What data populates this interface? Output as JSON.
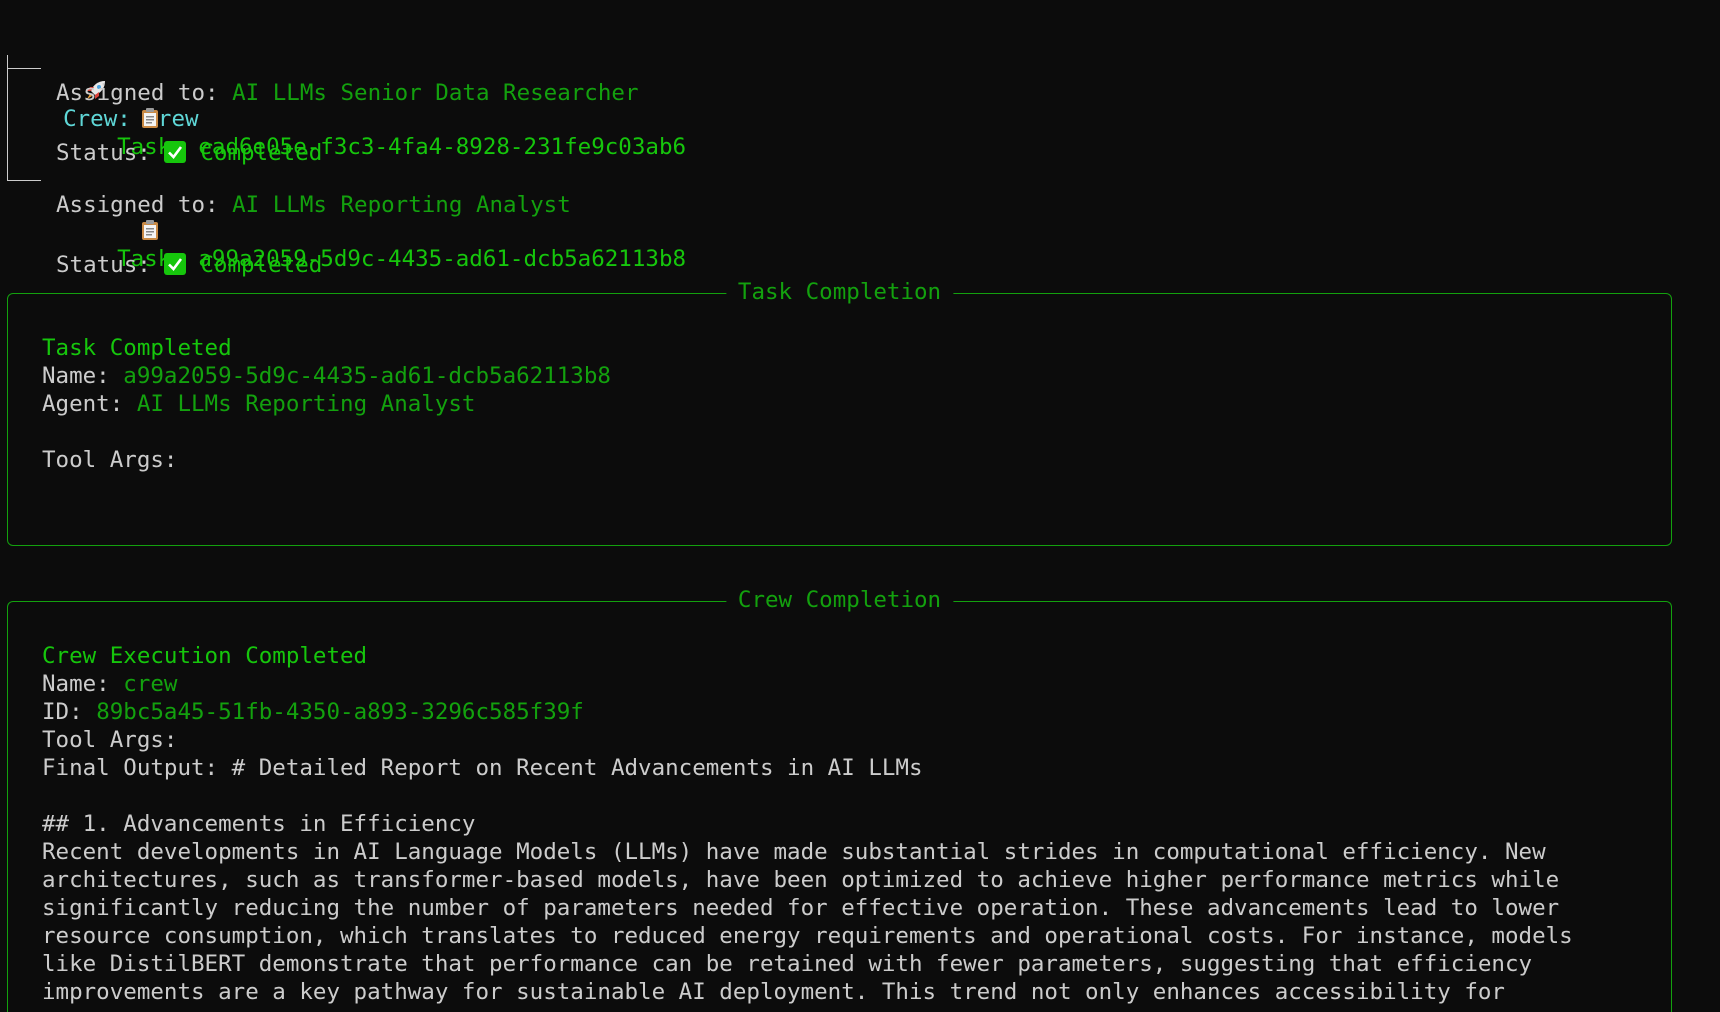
{
  "crew": {
    "label": "Crew:",
    "name": "crew"
  },
  "tasks": [
    {
      "label": "Task:",
      "id": "ead6e05e-f3c3-4fa4-8928-231fe9c03ab6",
      "assigned_label": "Assigned to:",
      "assigned_to": "AI LLMs Senior Data Researcher",
      "status_label": "Status:",
      "status": "Completed"
    },
    {
      "label": "Task:",
      "id": "a99a2059-5d9c-4435-ad61-dcb5a62113b8",
      "assigned_label": "Assigned to:",
      "assigned_to": "AI LLMs Reporting Analyst",
      "status_label": "Status:",
      "status": "Completed"
    }
  ],
  "task_panel": {
    "title": "Task Completion",
    "heading": "Task Completed",
    "name_label": "Name:",
    "name": "a99a2059-5d9c-4435-ad61-dcb5a62113b8",
    "agent_label": "Agent:",
    "agent": "AI LLMs Reporting Analyst",
    "tool_args_label": "Tool Args:"
  },
  "crew_panel": {
    "title": "Crew Completion",
    "heading": "Crew Execution Completed",
    "name_label": "Name:",
    "name": "crew",
    "id_label": "ID:",
    "id": "89bc5a45-51fb-4350-a893-3296c585f39f",
    "tool_args_label": "Tool Args:",
    "final_output_line": "Final Output: # Detailed Report on Recent Advancements in AI LLMs",
    "section_heading": "## 1. Advancements in Efficiency",
    "body_lines": [
      "Recent developments in AI Language Models (LLMs) have made substantial strides in computational efficiency. New",
      "architectures, such as transformer-based models, have been optimized to achieve higher performance metrics while",
      "significantly reducing the number of parameters needed for effective operation. These advancements lead to lower",
      "resource consumption, which translates to reduced energy requirements and operational costs. For instance, models",
      "like DistilBERT demonstrate that performance can be retained with fewer parameters, suggesting that efficiency",
      "improvements are a key pathway for sustainable AI deployment. This trend not only enhances accessibility for"
    ]
  },
  "colors": {
    "background": "#0c0c0c",
    "crew_cyan": "#5fd7d7",
    "success_green": "#16c60c",
    "panel_green": "#13a10e",
    "text": "#cccccc"
  },
  "icons": {
    "crew": "rocket-icon",
    "task": "clipboard-icon",
    "status": "check-icon"
  }
}
